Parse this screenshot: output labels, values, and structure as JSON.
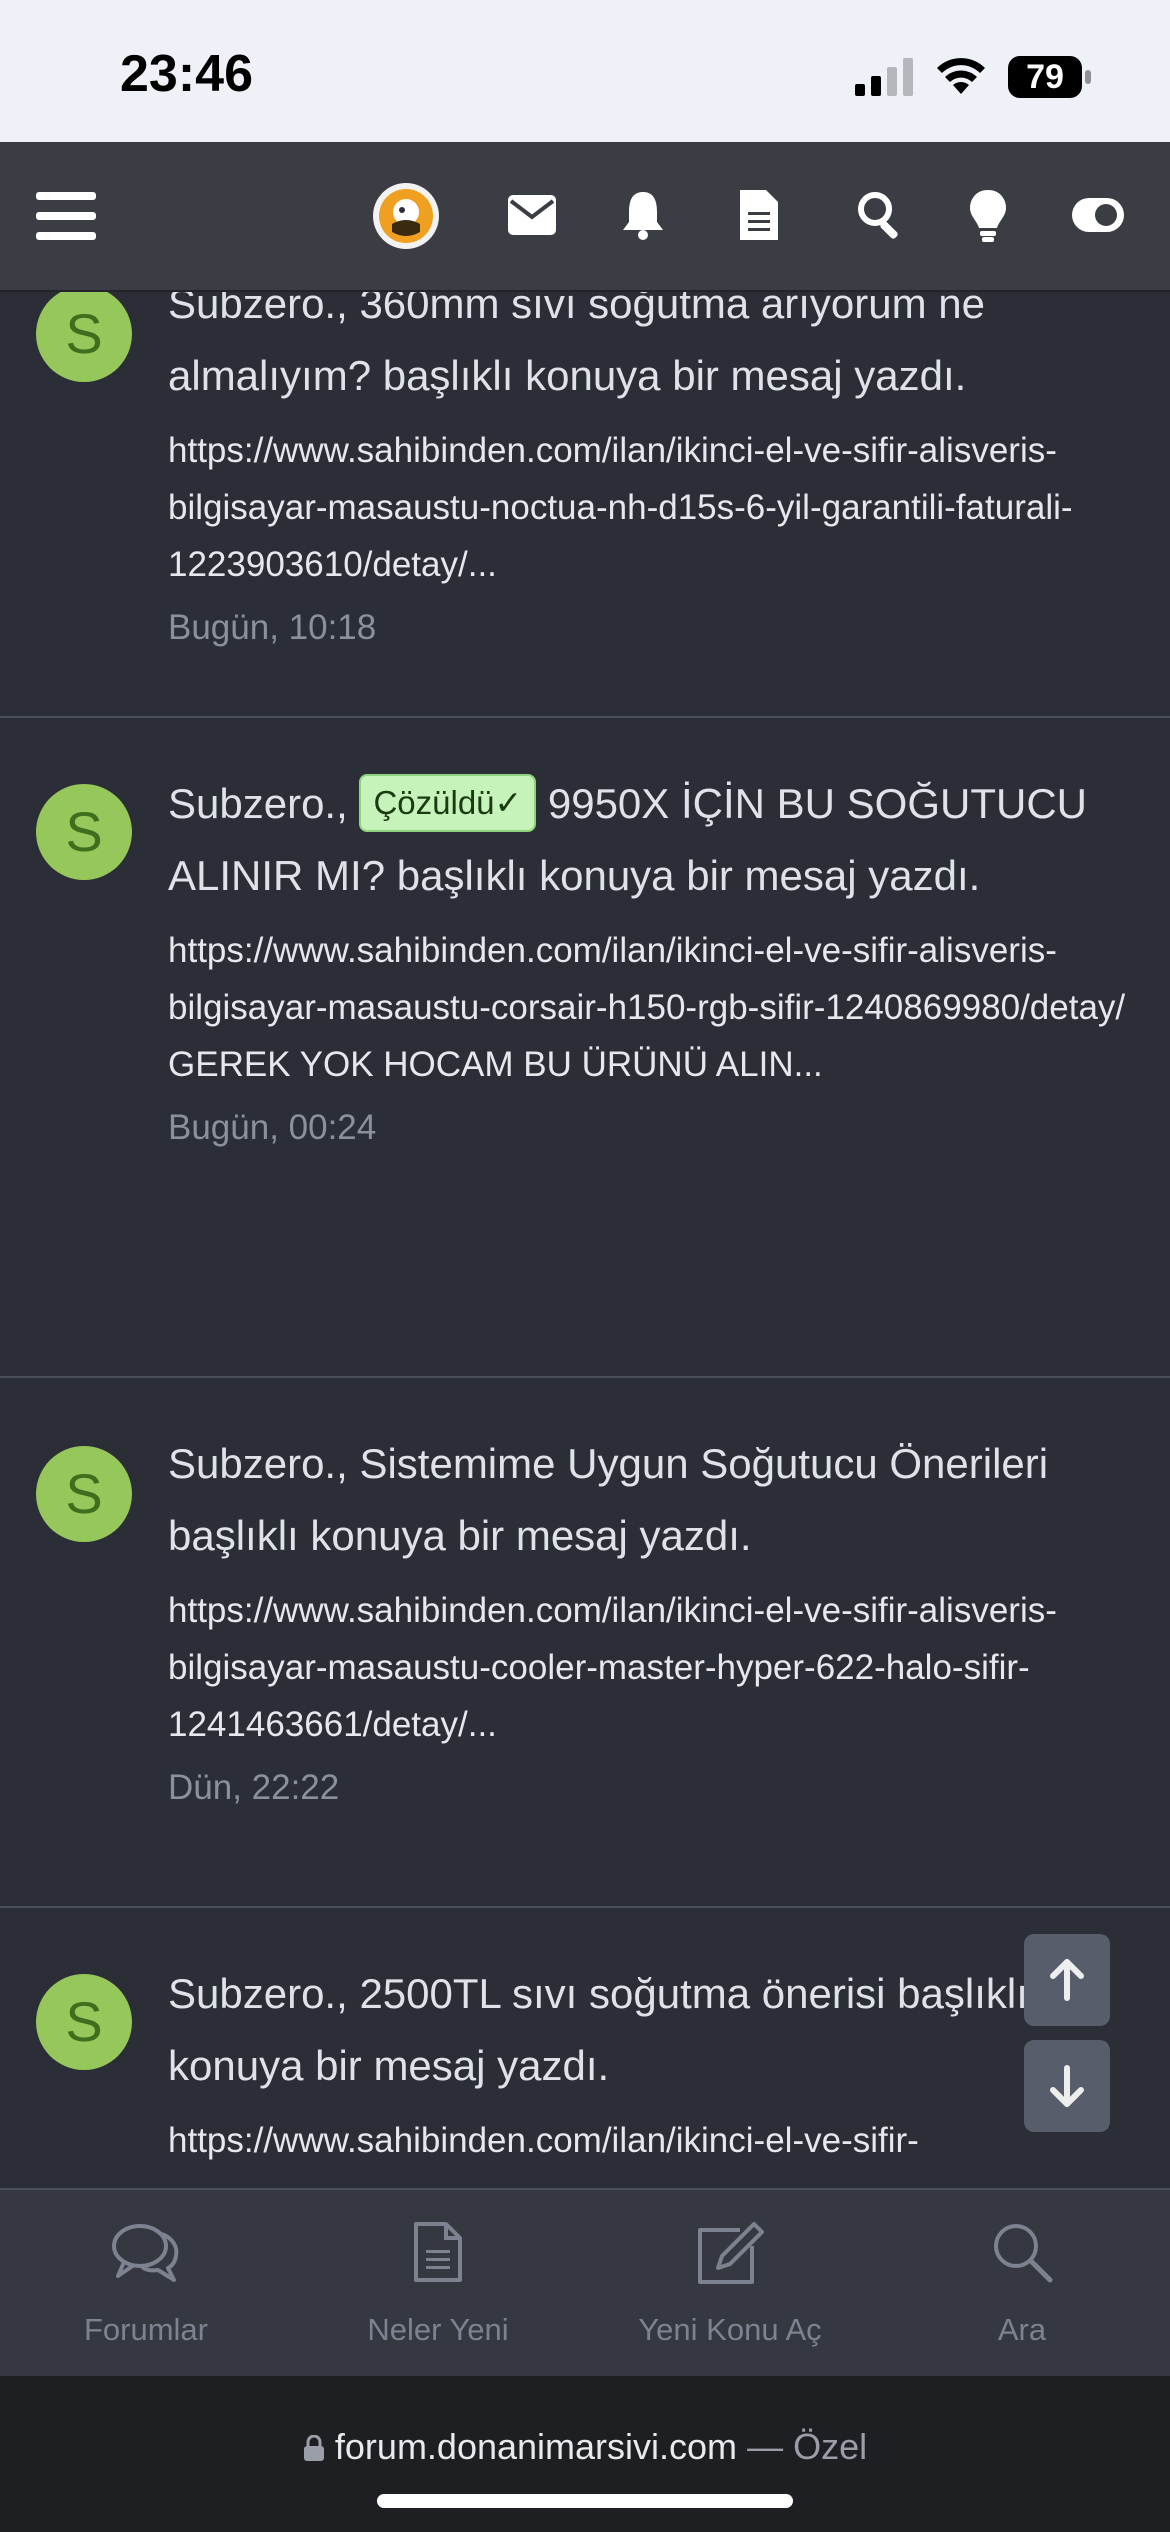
{
  "status_bar": {
    "time": "23:46",
    "battery": "79"
  },
  "header": {
    "icons": [
      "menu-icon",
      "site-logo",
      "mail-icon",
      "bell-icon",
      "document-icon",
      "search-icon",
      "lightbulb-icon",
      "theme-toggle-icon"
    ]
  },
  "entries": [
    {
      "avatar": "S",
      "title": "Subzero., 360mm sıvı soğutma arıyorum ne almalıyım? başlıklı konuya bir mesaj yazdı.",
      "snippet": "https://www.sahibinden.com/ilan/ikinci-el-ve-sifir-alisveris-bilgisayar-masaustu-noctua-nh-d15s-6-yil-garantili-faturali-1223903610/detay/...",
      "date": "Bugün, 10:18"
    },
    {
      "avatar": "S",
      "title_prefix": "Subzero.,",
      "badge": "Çözüldü✓",
      "title_rest": "9950X İÇİN BU SOĞUTUCU ALINIR MI? başlıklı konuya bir mesaj yazdı.",
      "snippet": "https://www.sahibinden.com/ilan/ikinci-el-ve-sifir-alisveris-bilgisayar-masaustu-corsair-h150-rgb-sifir-1240869980/detay/ GEREK YOK HOCAM BU ÜRÜNÜ ALIN...",
      "date": "Bugün, 00:24"
    },
    {
      "avatar": "S",
      "title": "Subzero., Sistemime Uygun Soğutucu Önerileri başlıklı konuya bir mesaj yazdı.",
      "snippet": "https://www.sahibinden.com/ilan/ikinci-el-ve-sifir-alisveris-bilgisayar-masaustu-cooler-master-hyper-622-halo-sifir-1241463661/detay/...",
      "date": "Dün, 22:22"
    },
    {
      "avatar": "S",
      "title": "Subzero., 2500TL sıvı soğutma önerisi başlıklı konuya bir mesaj yazdı.",
      "snippet": "https://www.sahibinden.com/ilan/ikinci-el-ve-sifir-",
      "date": ""
    }
  ],
  "tabbar": {
    "tabs": [
      {
        "label": "Forumlar",
        "icon": "forums-icon"
      },
      {
        "label": "Neler Yeni",
        "icon": "whats-new-icon"
      },
      {
        "label": "Yeni Konu Aç",
        "icon": "new-thread-icon"
      },
      {
        "label": "Ara",
        "icon": "search-icon"
      }
    ]
  },
  "browser": {
    "url": "forum.donanimarsivi.com",
    "mode": "— Özel"
  },
  "colors": {
    "background": "#2b2e36",
    "header": "#3a3d43",
    "avatar": "#95c75a",
    "badge": "#c6f3b9"
  }
}
